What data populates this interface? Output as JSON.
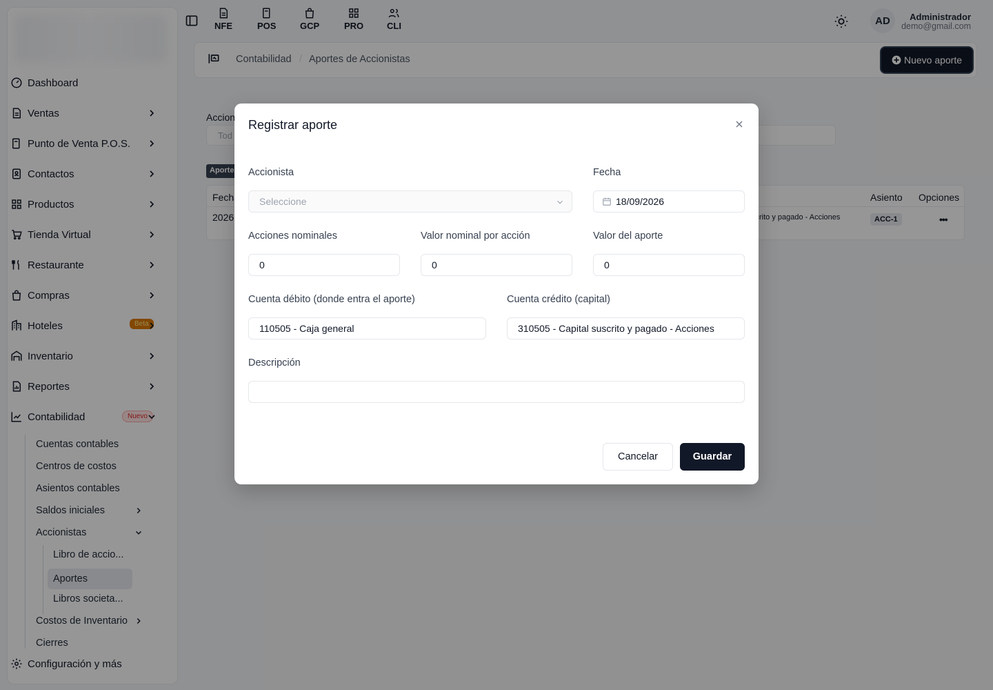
{
  "topbar": {
    "modules": [
      {
        "label": "NFE",
        "icon": "document-icon"
      },
      {
        "label": "POS",
        "icon": "pos-icon"
      },
      {
        "label": "GCP",
        "icon": "bag-icon"
      },
      {
        "label": "PRO",
        "icon": "grid-icon"
      },
      {
        "label": "CLI",
        "icon": "users-icon"
      }
    ],
    "avatar_initials": "AD",
    "user_name": "Administrador",
    "user_email": "demo@gmail.com"
  },
  "sidebar": {
    "items": [
      {
        "label": "Dashboard"
      },
      {
        "label": "Ventas"
      },
      {
        "label": "Punto de Venta P.O.S."
      },
      {
        "label": "Contactos"
      },
      {
        "label": "Productos"
      },
      {
        "label": "Tienda Virtual"
      },
      {
        "label": "Restaurante"
      },
      {
        "label": "Compras"
      },
      {
        "label": "Hoteles",
        "badge": "Beta"
      },
      {
        "label": "Inventario"
      },
      {
        "label": "Reportes"
      },
      {
        "label": "Contabilidad",
        "badge": "Nuevo"
      }
    ],
    "sub_items": [
      {
        "label": "Cuentas contables"
      },
      {
        "label": "Centros de costos"
      },
      {
        "label": "Asientos contables"
      },
      {
        "label": "Saldos iniciales"
      },
      {
        "label": "Accionistas"
      },
      {
        "label": "Costos de Inventario"
      },
      {
        "label": "Cierres"
      }
    ],
    "sub_sub_items": [
      {
        "label": "Libro de accio..."
      },
      {
        "label": "Aportes"
      },
      {
        "label": "Libros societa..."
      }
    ],
    "footer": "Configuración y más"
  },
  "breadcrumb": {
    "items": [
      "Contabilidad",
      "Aportes de Accionistas"
    ],
    "action_label": "Nuevo aporte"
  },
  "background": {
    "filter_label": "Accion",
    "filter_placeholder": "Tod",
    "tab_label": "Aporte",
    "headers": {
      "fecha": "Fecha",
      "asiento": "Asiento",
      "opciones": "Opciones"
    },
    "row": {
      "fecha": "2026",
      "cuenta": "scrito y pagado - Acciones",
      "asiento": "ACC-1"
    }
  },
  "modal": {
    "title": "Registrar aporte",
    "accionista_label": "Accionista",
    "accionista_placeholder": "Seleccione",
    "fecha_label": "Fecha",
    "fecha_value": "18/09/2026",
    "acciones_label": "Acciones nominales",
    "acciones_value": "0",
    "valor_nominal_label": "Valor nominal por acción",
    "valor_nominal_value": "0",
    "valor_aporte_label": "Valor del aporte",
    "valor_aporte_value": "0",
    "debito_label": "Cuenta débito (donde entra el aporte)",
    "debito_value": "110505 - Caja general",
    "credito_label": "Cuenta crédito (capital)",
    "credito_value": "310505 - Capital suscrito y pagado - Acciones",
    "descripcion_label": "Descripción",
    "descripcion_value": "",
    "cancel_label": "Cancelar",
    "save_label": "Guardar"
  },
  "colors": {
    "primary": "#111827",
    "beta": "#d97706",
    "new": "#dc2626",
    "overlay": "rgba(0,0,0,0.4)"
  }
}
